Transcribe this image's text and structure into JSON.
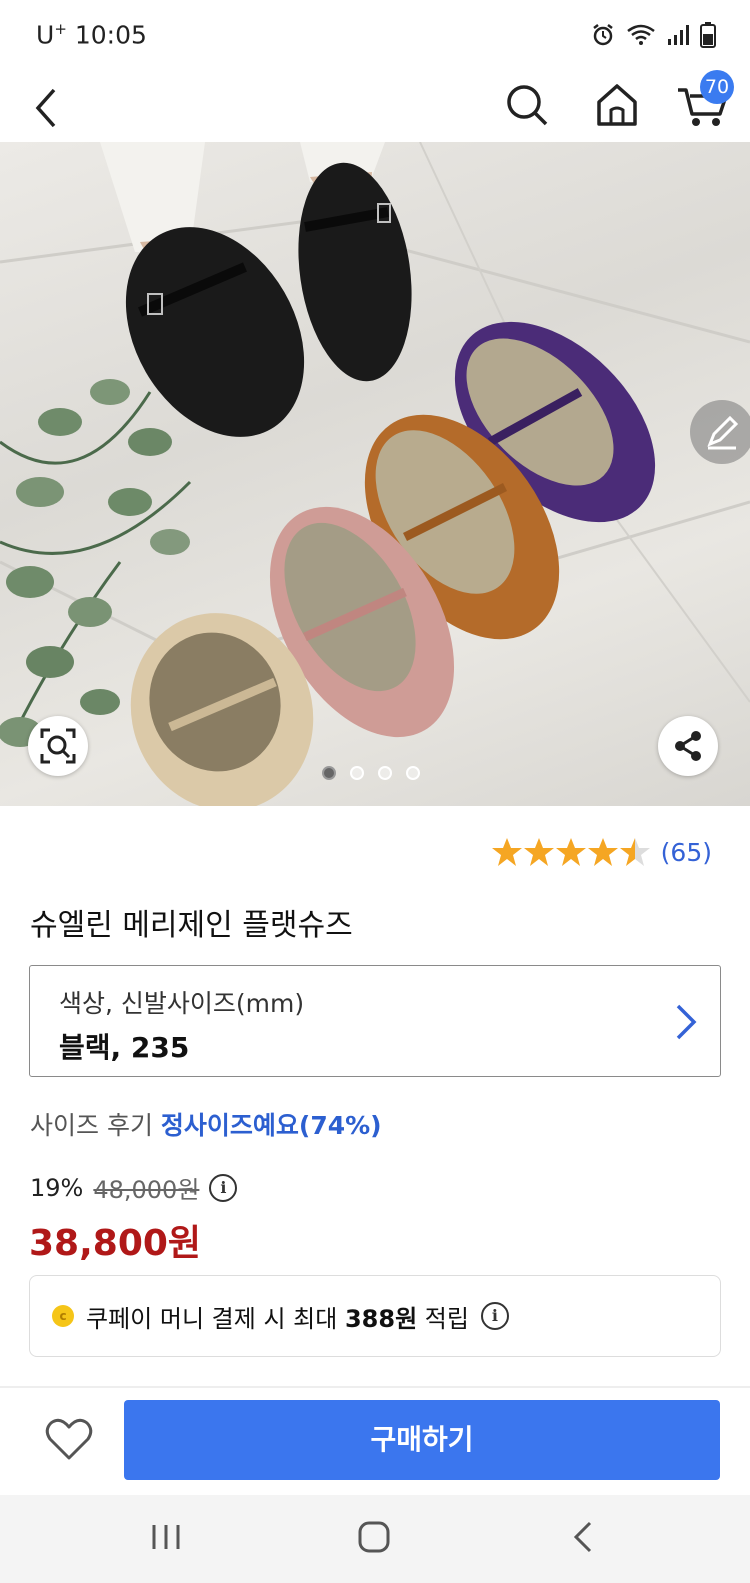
{
  "status_bar": {
    "carrier": "U",
    "carrier_sup": "+",
    "time": "10:05",
    "icons": [
      "alarm-icon",
      "wifi-icon",
      "signal-icon",
      "battery-icon"
    ]
  },
  "header": {
    "cart_count": "70",
    "icons": [
      "back-icon",
      "search-icon",
      "home-icon",
      "cart-icon"
    ]
  },
  "gallery": {
    "image_count": 4,
    "active_index": 0
  },
  "rating": {
    "stars": 4.5,
    "count": "(65)",
    "star_color": "#f5a623"
  },
  "product": {
    "title": "슈엘린 메리제인 플랫슈즈"
  },
  "option": {
    "label": "색상, 신발사이즈(mm)",
    "value": "블랙, 235"
  },
  "size_review": {
    "label": "사이즈 후기",
    "value": "정사이즈예요(74%)"
  },
  "price": {
    "discount_rate": "19%",
    "original": "48,000원",
    "sale": "38,800원",
    "sale_color": "#b01818"
  },
  "coupay": {
    "prefix": "쿠페이 머니 결제 시 최대",
    "amount": "388원",
    "suffix": "적립"
  },
  "actions": {
    "buy_label": "구매하기",
    "buy_color": "#3b76ee"
  }
}
